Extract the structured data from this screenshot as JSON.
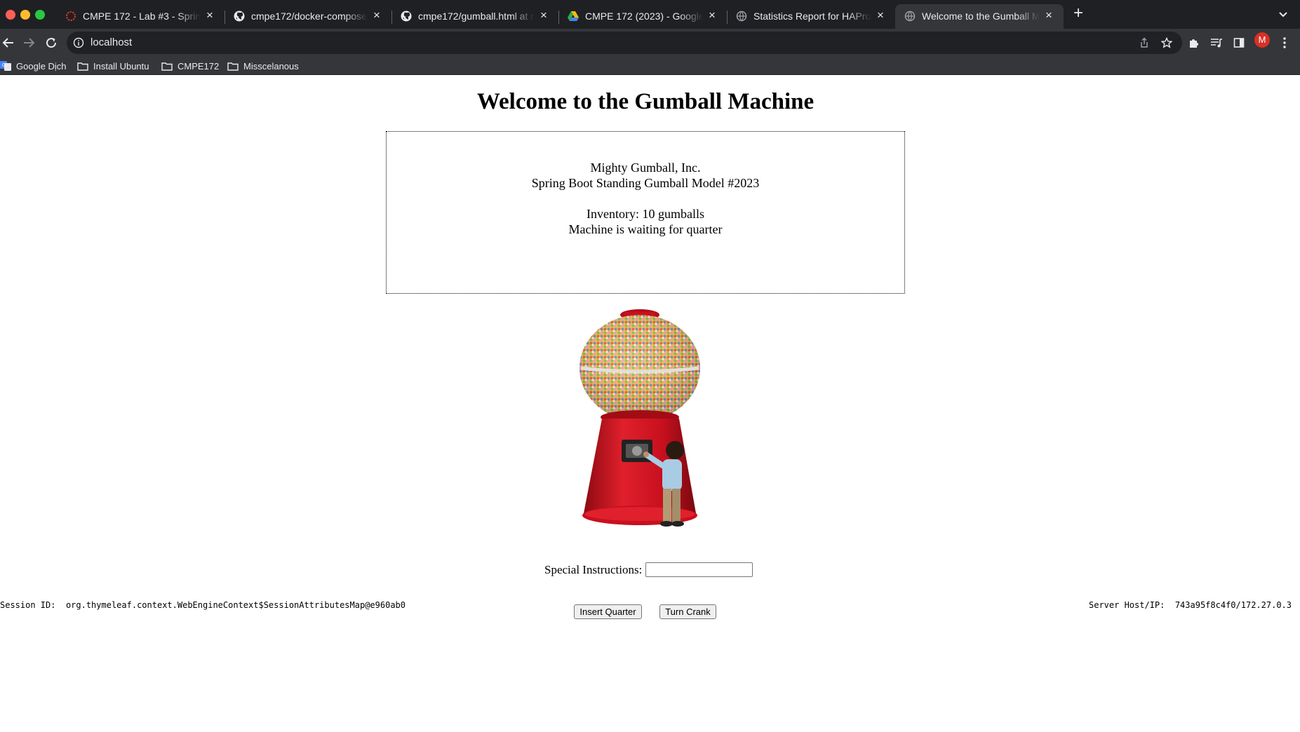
{
  "browser": {
    "tabs": [
      {
        "title": "CMPE 172 - Lab #3 - Spring Gu",
        "icon": "canvas-icon",
        "active": false
      },
      {
        "title": "cmpe172/docker-compose.yaml",
        "icon": "github-icon",
        "active": false
      },
      {
        "title": "cmpe172/gumball.html at main",
        "icon": "github-icon",
        "active": false
      },
      {
        "title": "CMPE 172 (2023) - Google Drive",
        "icon": "google-drive-icon",
        "active": false
      },
      {
        "title": "Statistics Report for HAProxy",
        "icon": "globe-icon",
        "active": false
      },
      {
        "title": "Welcome to the Gumball Machine",
        "icon": "globe-icon",
        "active": true
      }
    ],
    "address": "localhost",
    "profile_initial": "M",
    "bookmarks": [
      {
        "label": "Google Dịch",
        "icon": "google-translate-icon"
      },
      {
        "label": "Install Ubuntu",
        "icon": "folder-icon"
      },
      {
        "label": "CMPE172",
        "icon": "folder-icon"
      },
      {
        "label": "Misscelanous",
        "icon": "folder-icon"
      }
    ]
  },
  "page": {
    "title": "Welcome to the Gumball Machine",
    "company": "Mighty Gumball, Inc.",
    "model": "Spring Boot Standing Gumball Model #2023",
    "inventory": "Inventory: 10 gumballs",
    "state": "Machine is waiting for quarter",
    "image": "gumball-machine-image",
    "instructions_label": "Special Instructions:",
    "instructions_value": "",
    "insert_button": "Insert Quarter",
    "crank_button": "Turn Crank",
    "session_label": "Session ID:",
    "session_value": "org.thymeleaf.context.WebEngineContext$SessionAttributesMap@e960ab0",
    "server_label": "Server Host/IP:",
    "server_value": "743a95f8c4f0/172.27.0.3"
  },
  "colors": {
    "tabbar": "#1f2023",
    "toolbar": "#35363a",
    "omnibox": "#202124",
    "machine_red": "#c8101e",
    "avatar": "#d93025"
  }
}
